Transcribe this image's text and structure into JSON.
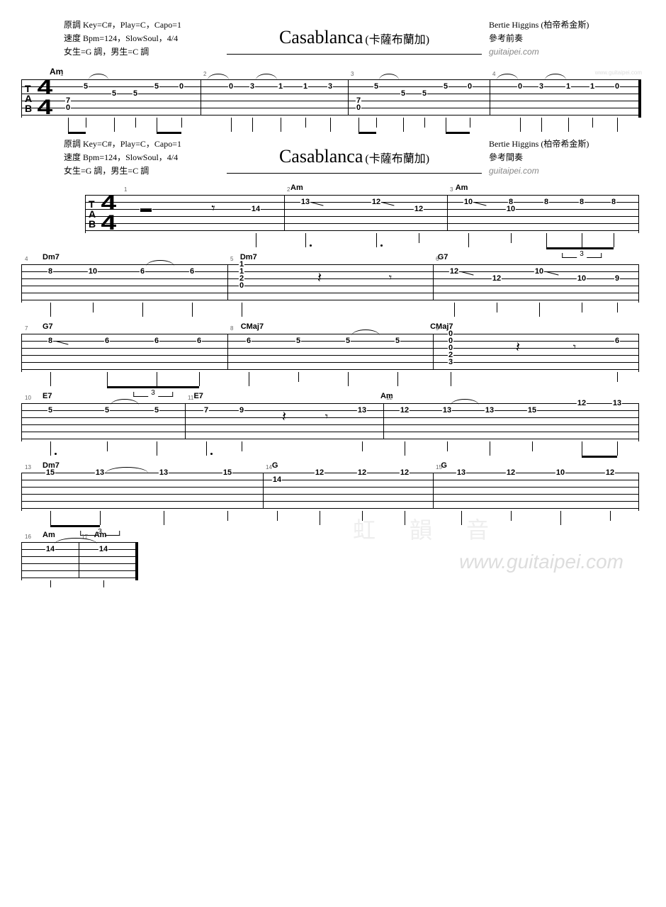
{
  "header1": {
    "line1": "原調 Key=C#，Play=C，Capo=1",
    "line2": "速度 Bpm=124，SlowSoul，4/4",
    "line3": "女生=G 調，男生=C 調",
    "title": "Casablanca",
    "subtitle": "(卡薩布蘭加)",
    "artist": "Bertie Higgins (柏帝希金斯)",
    "section": "參考前奏",
    "website": "guitaipei.com"
  },
  "header2": {
    "line1": "原調 Key=C#，Play=C，Capo=1",
    "line2": "速度 Bpm=124，SlowSoul，4/4",
    "line3": "女生=G 調，男生=C 調",
    "title": "Casablanca",
    "subtitle": "(卡薩布蘭加)",
    "artist": "Bertie Higgins (柏帝希金斯)",
    "section": "參考間奏",
    "website": "guitaipei.com"
  },
  "chords": {
    "am": "Am",
    "dm7": "Dm7",
    "g7": "G7",
    "cmaj7": "CMaj7",
    "e7": "E7",
    "g": "G"
  },
  "tab_letters": {
    "t": "T",
    "a": "A",
    "b": "B"
  },
  "time_sig": {
    "top": "4",
    "bot": "4"
  },
  "tuplet3": "3",
  "watermark_cn": "虹 韻 音",
  "watermark_url": "www.guitaipei.com",
  "staff1": {
    "bars": [
      1,
      2,
      3,
      4
    ],
    "notes": [
      {
        "bar": 1,
        "s": 5,
        "f": "0"
      },
      {
        "bar": 1,
        "s": 4,
        "f": "7"
      },
      {
        "bar": 1,
        "s": 2,
        "f": "5"
      },
      {
        "bar": 1,
        "s": 3,
        "f": "5"
      },
      {
        "bar": 1,
        "s": 3,
        "f": "5"
      },
      {
        "bar": 1,
        "s": 2,
        "f": "5"
      },
      {
        "bar": 1,
        "s": 2,
        "f": "0"
      },
      {
        "bar": 2,
        "s": 2,
        "f": "0"
      },
      {
        "bar": 2,
        "s": 2,
        "f": "3"
      },
      {
        "bar": 2,
        "s": 2,
        "f": "1"
      },
      {
        "bar": 2,
        "s": 2,
        "f": "1"
      },
      {
        "bar": 2,
        "s": 2,
        "f": "3"
      },
      {
        "bar": 3,
        "s": 5,
        "f": "0"
      },
      {
        "bar": 3,
        "s": 4,
        "f": "7"
      },
      {
        "bar": 3,
        "s": 2,
        "f": "5"
      },
      {
        "bar": 3,
        "s": 3,
        "f": "5"
      },
      {
        "bar": 3,
        "s": 3,
        "f": "5"
      },
      {
        "bar": 3,
        "s": 2,
        "f": "5"
      },
      {
        "bar": 3,
        "s": 2,
        "f": "0"
      },
      {
        "bar": 4,
        "s": 2,
        "f": "0"
      },
      {
        "bar": 4,
        "s": 2,
        "f": "3"
      },
      {
        "bar": 4,
        "s": 2,
        "f": "1"
      },
      {
        "bar": 4,
        "s": 2,
        "f": "1"
      },
      {
        "bar": 4,
        "s": 2,
        "f": "0"
      }
    ]
  },
  "staff2": {
    "bars": [
      1,
      2,
      3
    ],
    "chord_positions": {
      "am1": "Am",
      "am2": "Am"
    },
    "notes": [
      {
        "bar": 1,
        "rest": "half"
      },
      {
        "bar": 1,
        "rest": "eighth"
      },
      {
        "bar": 1,
        "s": 3,
        "f": "14"
      },
      {
        "bar": 2,
        "s": 2,
        "f": "13",
        "slide": true
      },
      {
        "bar": 2,
        "s": 2,
        "f": "12",
        "slide": true
      },
      {
        "bar": 2,
        "s": 3,
        "f": "12"
      },
      {
        "bar": 3,
        "s": 2,
        "f": "10",
        "slide": true
      },
      {
        "bar": 3,
        "s": 2,
        "f": "8"
      },
      {
        "bar": 3,
        "s": 2,
        "f": "8"
      },
      {
        "bar": 3,
        "s": 2,
        "f": "8"
      },
      {
        "bar": 3,
        "s": 2,
        "f": "8"
      },
      {
        "bar": 3,
        "s": 3,
        "f": "10"
      }
    ]
  },
  "staff3": {
    "bars": [
      4,
      5,
      6
    ],
    "chords": [
      "Dm7",
      "Dm7",
      "G7"
    ],
    "notes": [
      {
        "bar": 4,
        "s": 2,
        "f": "8"
      },
      {
        "bar": 4,
        "s": 2,
        "f": "10"
      },
      {
        "bar": 4,
        "s": 2,
        "f": "6"
      },
      {
        "bar": 4,
        "s": 2,
        "f": "6"
      },
      {
        "bar": 5,
        "s": 1,
        "f": "1"
      },
      {
        "bar": 5,
        "s": 2,
        "f": "1"
      },
      {
        "bar": 5,
        "s": 3,
        "f": "2"
      },
      {
        "bar": 5,
        "s": 4,
        "f": "0"
      },
      {
        "bar": 5,
        "rest": "quarter"
      },
      {
        "bar": 5,
        "rest": "eighth"
      },
      {
        "bar": 6,
        "s": 2,
        "f": "12",
        "slide": true
      },
      {
        "bar": 6,
        "s": 3,
        "f": "12"
      },
      {
        "bar": 6,
        "s": 2,
        "f": "10",
        "slide": true
      },
      {
        "bar": 6,
        "s": 3,
        "f": "10"
      },
      {
        "bar": 6,
        "s": 3,
        "f": "9"
      }
    ]
  },
  "staff4": {
    "bars": [
      7,
      8,
      9
    ],
    "chords": [
      "G7",
      "CMaj7",
      "CMaj7"
    ],
    "notes": [
      {
        "bar": 7,
        "s": 2,
        "f": "8",
        "slide": true
      },
      {
        "bar": 7,
        "s": 2,
        "f": "6"
      },
      {
        "bar": 7,
        "s": 2,
        "f": "6"
      },
      {
        "bar": 7,
        "s": 2,
        "f": "6"
      },
      {
        "bar": 8,
        "s": 2,
        "f": "6"
      },
      {
        "bar": 8,
        "s": 2,
        "f": "5"
      },
      {
        "bar": 8,
        "s": 2,
        "f": "5"
      },
      {
        "bar": 8,
        "s": 2,
        "f": "5"
      },
      {
        "bar": 9,
        "s": 1,
        "f": "0"
      },
      {
        "bar": 9,
        "s": 2,
        "f": "0"
      },
      {
        "bar": 9,
        "s": 3,
        "f": "0"
      },
      {
        "bar": 9,
        "s": 4,
        "f": "2"
      },
      {
        "bar": 9,
        "s": 5,
        "f": "3"
      },
      {
        "bar": 9,
        "rest": "quarter"
      },
      {
        "bar": 9,
        "rest": "eighth"
      },
      {
        "bar": 9,
        "s": 2,
        "f": "6"
      }
    ]
  },
  "staff5": {
    "bars": [
      10,
      11,
      12
    ],
    "chords": [
      "E7",
      "E7",
      "Am"
    ],
    "notes": [
      {
        "bar": 10,
        "s": 2,
        "f": "5"
      },
      {
        "bar": 10,
        "s": 2,
        "f": "5"
      },
      {
        "bar": 10,
        "s": 2,
        "f": "5"
      },
      {
        "bar": 11,
        "s": 2,
        "f": "7"
      },
      {
        "bar": 11,
        "s": 2,
        "f": "9"
      },
      {
        "bar": 11,
        "rest": "quarter"
      },
      {
        "bar": 11,
        "rest": "eighth"
      },
      {
        "bar": 11,
        "s": 2,
        "f": "13"
      },
      {
        "bar": 12,
        "s": 2,
        "f": "12"
      },
      {
        "bar": 12,
        "s": 2,
        "f": "13"
      },
      {
        "bar": 12,
        "s": 2,
        "f": "13"
      },
      {
        "bar": 12,
        "s": 2,
        "f": "15"
      },
      {
        "bar": 12,
        "s": 1,
        "f": "12"
      },
      {
        "bar": 12,
        "s": 1,
        "f": "13"
      }
    ]
  },
  "staff6": {
    "bars": [
      13,
      14,
      15
    ],
    "chords": [
      "Dm7",
      "G",
      "G"
    ],
    "notes": [
      {
        "bar": 13,
        "s": 1,
        "f": "15"
      },
      {
        "bar": 13,
        "s": 1,
        "f": "13"
      },
      {
        "bar": 13,
        "s": 1,
        "f": "13"
      },
      {
        "bar": 13,
        "s": 1,
        "f": "15"
      },
      {
        "bar": 14,
        "s": 2,
        "f": "14"
      },
      {
        "bar": 14,
        "s": 1,
        "f": "12"
      },
      {
        "bar": 14,
        "s": 1,
        "f": "12"
      },
      {
        "bar": 14,
        "s": 1,
        "f": "12"
      },
      {
        "bar": 15,
        "s": 1,
        "f": "13"
      },
      {
        "bar": 15,
        "s": 1,
        "f": "12"
      },
      {
        "bar": 15,
        "s": 1,
        "f": "10"
      },
      {
        "bar": 15,
        "s": 1,
        "f": "12"
      }
    ]
  },
  "staff7": {
    "bars": [
      16,
      17
    ],
    "chords": [
      "Am",
      "Am"
    ],
    "notes": [
      {
        "bar": 16,
        "s": 2,
        "f": "14"
      },
      {
        "bar": 17,
        "s": 2,
        "f": "14"
      }
    ]
  }
}
